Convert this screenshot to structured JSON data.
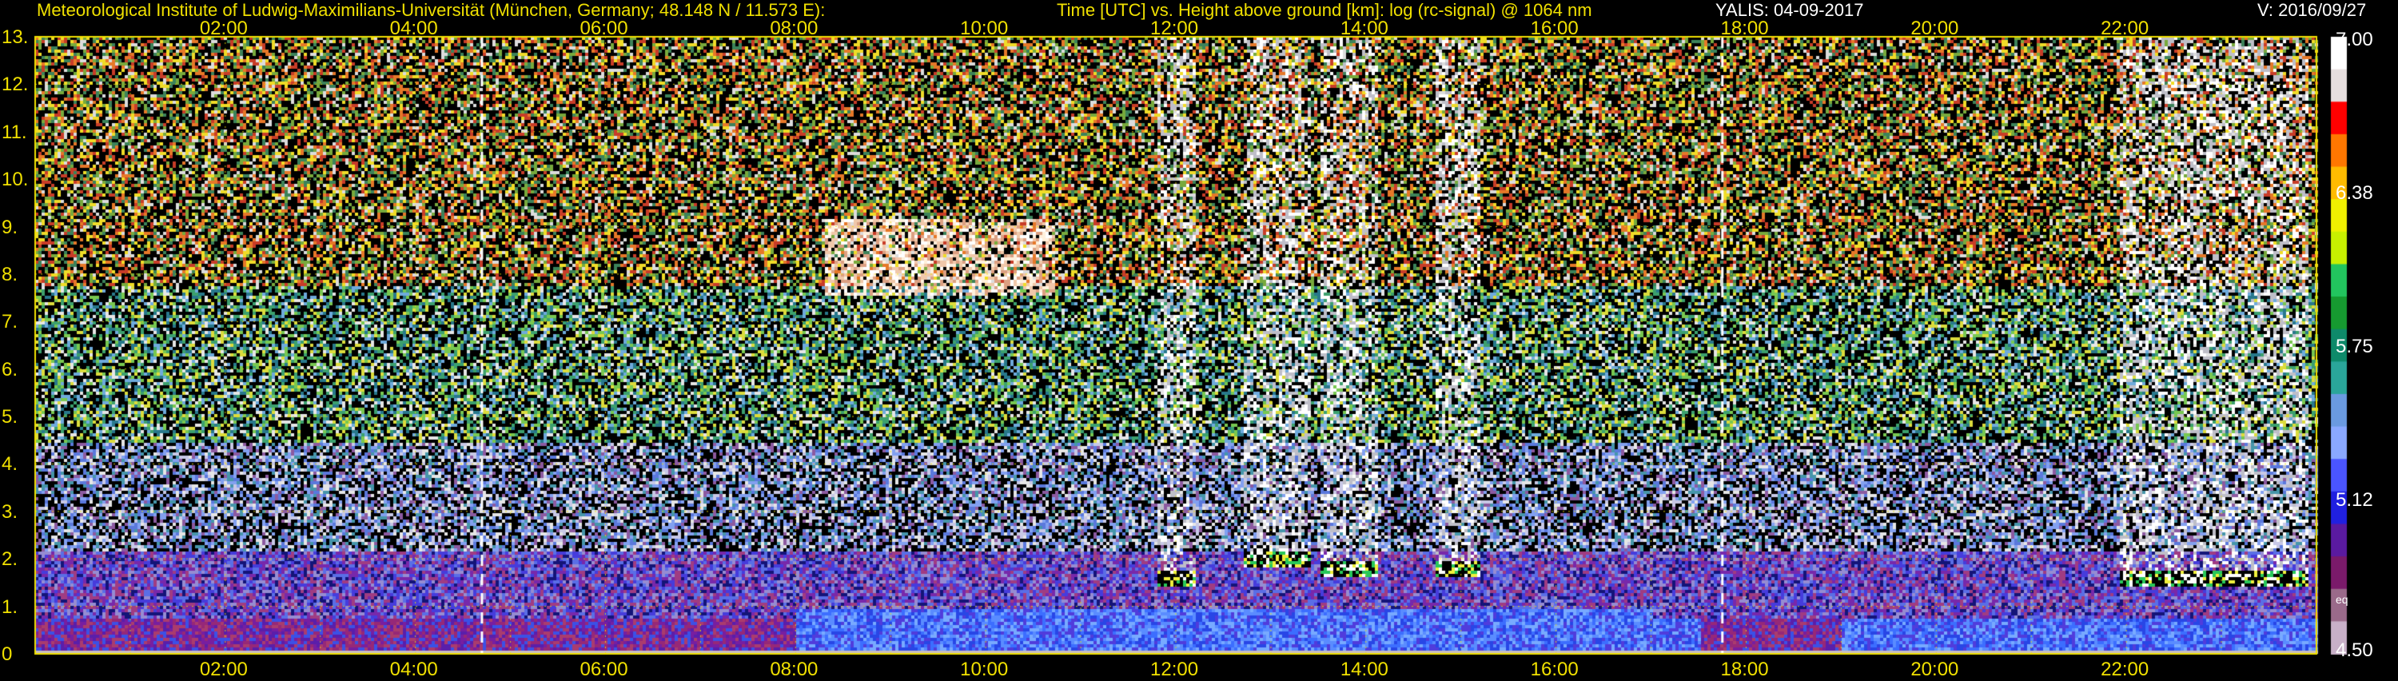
{
  "header": {
    "institute": "Meteorological Institute of Ludwig-Maximilians-Universität (München, Germany; 48.148 N / 11.573 E):",
    "plot_title": "Time [UTC] vs. Height above ground [km]: log (rc-signal) @ 1064 nm",
    "station_date": "YALIS: 04-09-2017",
    "version": "V: 2016/09/27"
  },
  "colorbar": {
    "labels": [
      "7.00",
      "6.38",
      "5.75",
      "5.12",
      "4.50"
    ],
    "eq_label": "eq",
    "colors": [
      "#ffffff",
      "#e6dede",
      "#ff0000",
      "#ff7700",
      "#ffbb00",
      "#f0f000",
      "#c8f000",
      "#22c55e",
      "#169a30",
      "#0e8a6a",
      "#2aa69a",
      "#6a9ae0",
      "#8aa8ff",
      "#4a55ff",
      "#2020e0",
      "#5a1aa0",
      "#7a1a6a",
      "#9a6a8a",
      "#c8b0c8"
    ]
  },
  "chart_data": {
    "type": "heatmap",
    "title": "Time [UTC] vs. Height above ground [km]: log (rc-signal) @ 1064 nm",
    "x_ticks": [
      "02:00",
      "04:00",
      "06:00",
      "08:00",
      "10:00",
      "12:00",
      "14:00",
      "16:00",
      "18:00",
      "20:00",
      "22:00"
    ],
    "y_ticks": [
      "0",
      "1.",
      "2.",
      "3.",
      "4.",
      "5.",
      "6.",
      "7.",
      "8.",
      "9.",
      "10.",
      "11.",
      "12.",
      "13."
    ],
    "xlim_hours": [
      0,
      24
    ],
    "ylim_km": [
      0,
      13
    ],
    "color_range": [
      4.5,
      7.0
    ],
    "grid": true,
    "dashed_markers_hours": [
      4.7,
      17.75
    ],
    "features": {
      "boundary_layer_top_km": 1.0,
      "cirrus": {
        "time_hours": [
          8.3,
          10.7
        ],
        "height_km": [
          7.6,
          9.2
        ]
      },
      "cumulus_columns": [
        {
          "time_hours": [
            11.8,
            12.2
          ],
          "base_km": 1.6
        },
        {
          "time_hours": [
            12.7,
            13.4
          ],
          "base_km": 2.0
        },
        {
          "time_hours": [
            13.5,
            14.1
          ],
          "base_km": 1.8
        },
        {
          "time_hours": [
            14.7,
            15.2
          ],
          "base_km": 1.8
        },
        {
          "time_hours": [
            21.9,
            23.9
          ],
          "base_km": 1.6
        }
      ]
    }
  }
}
